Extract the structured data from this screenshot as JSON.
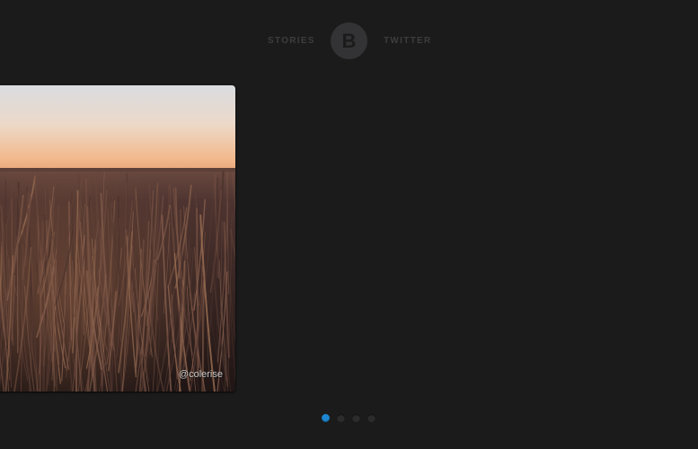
{
  "nav": {
    "left_link": "STORIES",
    "logo_letter": "B",
    "right_link": "TWITTER"
  },
  "slide": {
    "photo_credit": "@colerise",
    "image_description": "wheat-field-at-dusk"
  },
  "pagination": {
    "total": 4,
    "active": 1
  },
  "colors": {
    "background": "#1b1b1b",
    "nav_text": "#3d3d3d",
    "logo_circle": "#333335",
    "active_dot": "#1e86d0",
    "inactive_dot": "#2c2c2c"
  }
}
